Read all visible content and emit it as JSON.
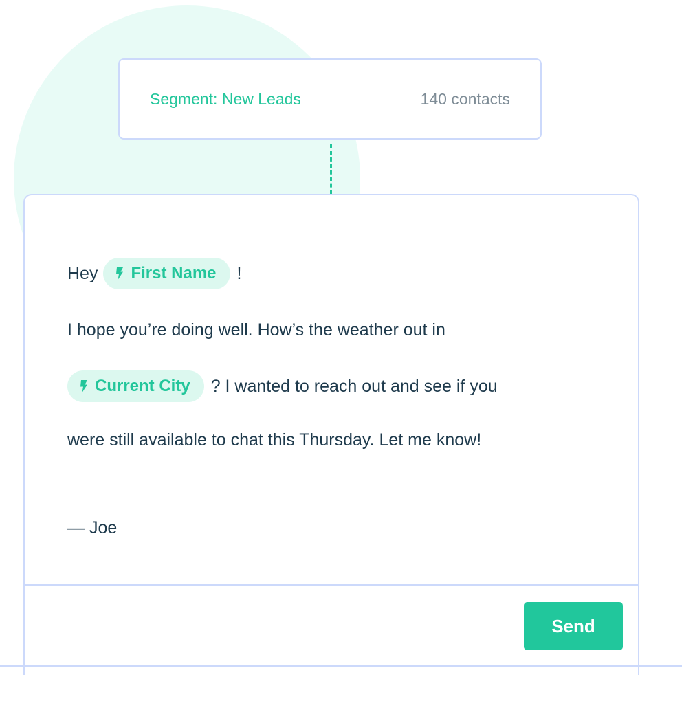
{
  "segment": {
    "label": "Segment: New Leads",
    "count": "140 contacts"
  },
  "message": {
    "greeting_prefix": "Hey",
    "greeting_suffix": "!",
    "line_2": "I hope you’re doing well. How’s the weather out in",
    "line_3_suffix": "? I wanted to reach out and see if you",
    "line_4": "were still available to chat this Thursday. Let me know!",
    "signature": "— Joe",
    "tokens": [
      {
        "label": "First Name",
        "icon": "lightning-icon"
      },
      {
        "label": "Current City",
        "icon": "lightning-icon"
      }
    ]
  },
  "actions": {
    "send_label": "Send"
  },
  "colors": {
    "accent": "#23c69b",
    "border": "#ccd9fb",
    "token_bg": "#dcf8ef",
    "circle_bg": "#e8fbf6",
    "text": "#1e3a4c",
    "muted": "#7e8c96"
  }
}
